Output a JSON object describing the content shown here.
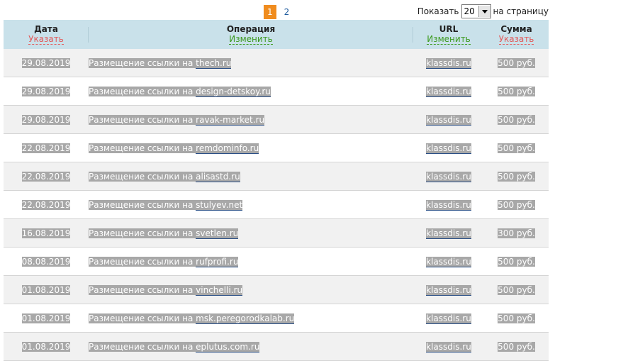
{
  "pager": {
    "pages": [
      "1",
      "2"
    ],
    "active": "1"
  },
  "perpage": {
    "prefix": "Показать",
    "value": "20",
    "suffix": "на страницу"
  },
  "columns": {
    "date": {
      "title": "Дата",
      "action": "Указать"
    },
    "operation": {
      "title": "Операция",
      "action": "Изменить"
    },
    "url": {
      "title": "URL",
      "action": "Изменить"
    },
    "sum": {
      "title": "Сумма",
      "action": "Указать"
    }
  },
  "rows": [
    {
      "date": "29.08.2019",
      "op_prefix": "Размещение ссылки на ",
      "op_link": "thech.ru",
      "url": "klassdis.ru",
      "sum": "500 руб."
    },
    {
      "date": "29.08.2019",
      "op_prefix": "Размещение ссылки на ",
      "op_link": "design-detskoy.ru",
      "url": "klassdis.ru",
      "sum": "500 руб."
    },
    {
      "date": "29.08.2019",
      "op_prefix": "Размещение ссылки на ",
      "op_link": "ravak-market.ru",
      "url": "klassdis.ru",
      "sum": "500 руб."
    },
    {
      "date": "22.08.2019",
      "op_prefix": "Размещение ссылки на ",
      "op_link": "remdominfo.ru",
      "url": "klassdis.ru",
      "sum": "500 руб."
    },
    {
      "date": "22.08.2019",
      "op_prefix": "Размещение ссылки на ",
      "op_link": "alisastd.ru",
      "url": "klassdis.ru",
      "sum": "500 руб."
    },
    {
      "date": "22.08.2019",
      "op_prefix": "Размещение ссылки на ",
      "op_link": "stulyev.net",
      "url": "klassdis.ru",
      "sum": "500 руб."
    },
    {
      "date": "16.08.2019",
      "op_prefix": "Размещение ссылки на ",
      "op_link": "svetlen.ru",
      "url": "klassdis.ru",
      "sum": "300 руб."
    },
    {
      "date": "08.08.2019",
      "op_prefix": "Размещение ссылки на ",
      "op_link": "rufprofi.ru",
      "url": "klassdis.ru",
      "sum": "500 руб."
    },
    {
      "date": "01.08.2019",
      "op_prefix": "Размещение ссылки на ",
      "op_link": "vinchelli.ru",
      "url": "klassdis.ru",
      "sum": "500 руб."
    },
    {
      "date": "01.08.2019",
      "op_prefix": "Размещение ссылки на ",
      "op_link": "msk.peregorodkalab.ru",
      "url": "klassdis.ru",
      "sum": "500 руб."
    },
    {
      "date": "01.08.2019",
      "op_prefix": "Размещение ссылки на ",
      "op_link": "eplutus.com.ru",
      "url": "klassdis.ru",
      "sum": "500 руб."
    }
  ],
  "colors": {
    "header_bg": "#c9e1ea",
    "active_page": "#f08c1e",
    "sort_red": "#e25b5b",
    "sort_green": "#3c9a1e",
    "highlight": "#a8a8a8"
  }
}
